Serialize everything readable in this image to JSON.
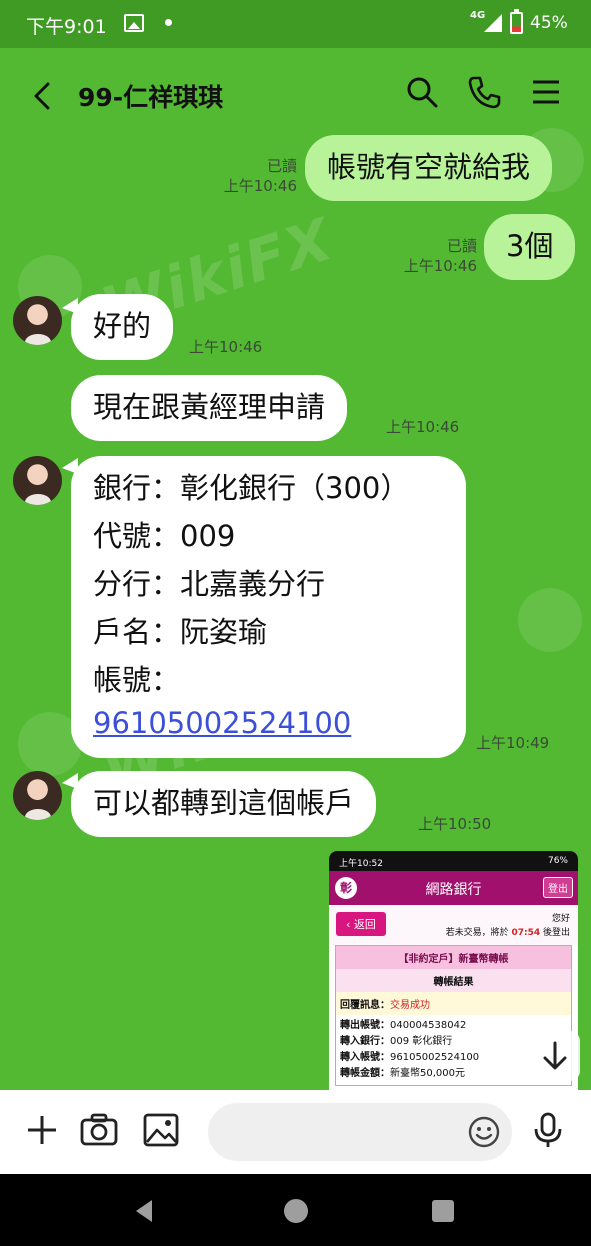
{
  "status_bar": {
    "time": "下午9:01",
    "network": "4G",
    "battery": "45%"
  },
  "header": {
    "contact_name": "99-仁祥琪琪"
  },
  "messages": [
    {
      "side": "me",
      "text": "帳號有空就給我",
      "read": "已讀",
      "time": "上午10:46"
    },
    {
      "side": "me",
      "text": "3個",
      "read": "已讀",
      "time": "上午10:46"
    },
    {
      "side": "them",
      "text": "好的",
      "time": "上午10:46"
    },
    {
      "side": "them",
      "text": "現在跟黃經理申請",
      "time": "上午10:46"
    },
    {
      "side": "them",
      "lines": [
        "銀行：彰化銀行（300）",
        "代號：009",
        "分行：北嘉義分行",
        "戶名：阮姿瑜",
        "帳號："
      ],
      "account_link": "96105002524100",
      "time": "上午10:49"
    },
    {
      "side": "them",
      "text": "可以都轉到這個帳戶",
      "time": "上午10:50"
    }
  ],
  "image_message": {
    "status_time": "上午10:52",
    "status_battery": "76%",
    "logo_char": "彰",
    "title": "網路銀行",
    "logout": "登出",
    "return": "返回",
    "hello": "您好",
    "warn_prefix": "若未交易，將於",
    "warn_time": "07:54",
    "warn_suffix": "後登出",
    "row_title": "【非約定戶】新臺幣轉帳",
    "row_result": "轉帳結果",
    "reply_label": "回覆訊息：",
    "reply_value": "交易成功",
    "fields": [
      {
        "k": "轉出帳號：",
        "v": "040004538042"
      },
      {
        "k": "轉入銀行：",
        "v": "009 彰化銀行"
      },
      {
        "k": "轉入帳號：",
        "v": "96105002524100"
      },
      {
        "k": "轉帳金額：",
        "v": "新臺幣50,000元"
      }
    ]
  },
  "composer": {
    "placeholder": ""
  },
  "watermark": "WikiFX"
}
